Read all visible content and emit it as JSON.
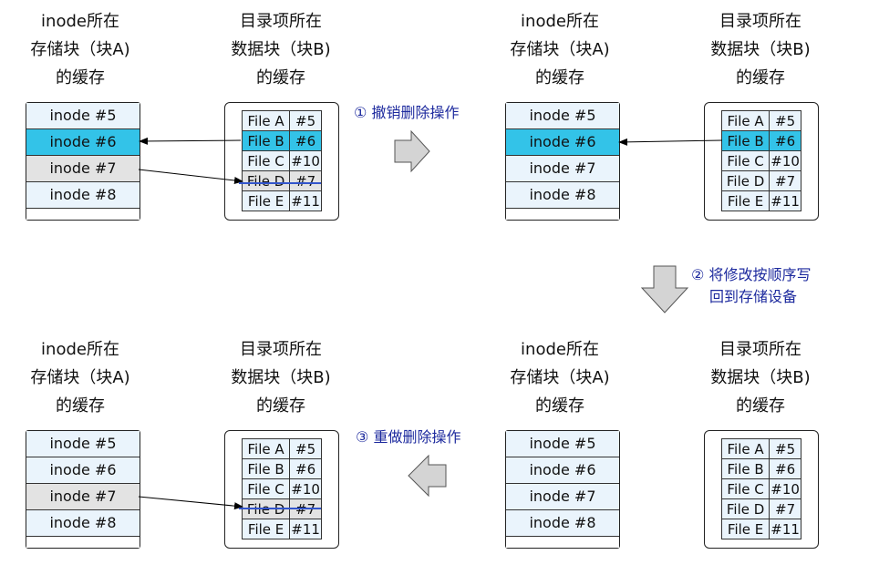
{
  "caption_a": [
    "inode所在",
    "存储块（块A)",
    "的缓存"
  ],
  "caption_b": [
    "目录项所在",
    "数据块（块B)",
    "的缓存"
  ],
  "inodes": [
    "inode #5",
    "inode #6",
    "inode #7",
    "inode #8"
  ],
  "entries": [
    {
      "name": "File A",
      "inode": "#5"
    },
    {
      "name": "File B",
      "inode": "#6"
    },
    {
      "name": "File C",
      "inode": "#10"
    },
    {
      "name": "File D",
      "inode": "#7"
    },
    {
      "name": "File E",
      "inode": "#11"
    }
  ],
  "steps": {
    "s1": {
      "marker": "①",
      "text": "撤销删除操作"
    },
    "s2": {
      "marker": "②",
      "line1": "将修改按顺序写",
      "line2": "回到存储设备"
    },
    "s3": {
      "marker": "③",
      "text": "重做删除操作"
    }
  },
  "colors": {
    "highlight": "#33c3e8",
    "cached": "#eaf4fc",
    "gray": "#e3e3e3",
    "step_text": "#1d2a9e",
    "strike": "#3355cc",
    "arrow_fill": "#d4d4d4"
  }
}
